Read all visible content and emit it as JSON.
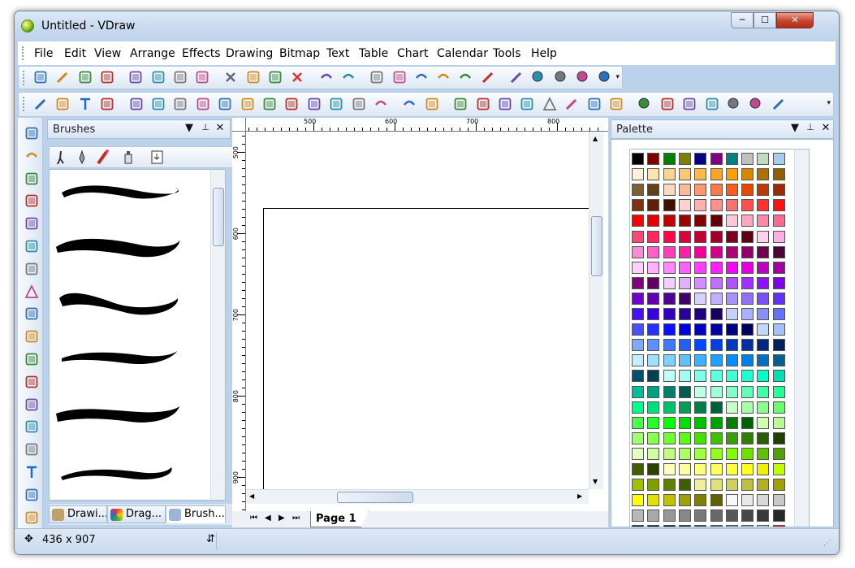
{
  "window": {
    "title": "Untitled - VDraw",
    "controls": [
      "─",
      "☐",
      "✕"
    ]
  },
  "menu": [
    "File",
    "Edit",
    "View",
    "Arrange",
    "Effects",
    "Drawing",
    "Bitmap",
    "Text",
    "Table",
    "Chart",
    "Calendar",
    "Tools",
    "Help"
  ],
  "toolbar_main": [
    "new-icon",
    "open-icon",
    "save-icon",
    "image-icon",
    "pdf-icon",
    "print-icon",
    "print-preview-icon",
    "frame-icon",
    "cut-icon",
    "copy-icon",
    "paste-icon",
    "delete-icon",
    "undo-icon",
    "redo-icon",
    "group-icon",
    "align-icon",
    "back-icon",
    "forward-icon",
    "rotate-icon",
    "pen-icon",
    "brush-icon",
    "zoom-in-icon",
    "zoom-out-icon",
    "zoom-100-icon",
    "help-icon"
  ],
  "toolbar_effects": [
    "pencil-icon",
    "gradient-icon",
    "texture-icon",
    "pattern-icon",
    "dots-icon",
    "grid-icon",
    "square-fill-icon",
    "cube-icon",
    "eraser-icon",
    "cylinder-icon",
    "hexagon-icon",
    "frame-square-icon",
    "mirror-icon",
    "leaf-icon",
    "flower-icon",
    "wave-icon",
    "twist-icon",
    "shadow-icon",
    "crop-icon",
    "dark-square-icon",
    "bevel-icon",
    "emboss-icon",
    "tree-icon",
    "ink-icon",
    "list-icon",
    "tag-icon",
    "ring-icon",
    "mosaic-icon",
    "gear-icon",
    "lasso-icon",
    "target-icon",
    "circle-dash-icon",
    "marker-icon"
  ],
  "left_tools": [
    "pointer-icon",
    "curve-icon",
    "rectangle-icon",
    "connector-icon",
    "dimension-icon",
    "flow-icon",
    "cup-icon",
    "triangle-icon",
    "film-icon",
    "org-chart-icon",
    "note-icon",
    "puzzle-icon",
    "layers-icon",
    "table-icon",
    "bar-chart-icon",
    "text-icon",
    "calendar-icon",
    "corner-icon"
  ],
  "brushes_panel": {
    "title": "Brushes",
    "controls": [
      "▼",
      "📌",
      "✕"
    ],
    "tabs": [
      {
        "label": "Drawi...",
        "icon": "drawing-tab-icon"
      },
      {
        "label": "Drag...",
        "icon": "drag-tab-icon"
      },
      {
        "label": "Brush...",
        "icon": "brush-tab-icon"
      }
    ]
  },
  "canvas": {
    "ruler_h": [
      "500",
      "600",
      "700",
      "800"
    ],
    "ruler_v": [
      "500",
      "600",
      "700",
      "800",
      "900"
    ],
    "page_tab": "Page 1"
  },
  "palette_panel": {
    "title": "Palette",
    "controls": [
      "▼",
      "📌",
      "✕"
    ]
  },
  "palette_rows": [
    [
      "#000000",
      "#800000",
      "#008000",
      "#808000",
      "#000080",
      "#800080",
      "#008080",
      "#c0c0c0",
      "#c0dcc0",
      "#a6caf0"
    ],
    [
      "#fff0d8",
      "#ffe4b0",
      "#ffd490",
      "#ffc870",
      "#ffb84c",
      "#ffa42a",
      "#ffa000",
      "#d88800",
      "#b07000",
      "#906000"
    ],
    [
      "#806030",
      "#604018",
      "#ffd8c0",
      "#ffb898",
      "#ff9870",
      "#ff7848",
      "#ff5a20",
      "#e84800",
      "#c03800",
      "#a02800"
    ],
    [
      "#803010",
      "#602008",
      "#401000",
      "#ffd0d0",
      "#ffb0b0",
      "#ff9090",
      "#ff7070",
      "#ff5050",
      "#ff3030",
      "#ff1010"
    ],
    [
      "#ff0000",
      "#e00000",
      "#c00000",
      "#a00000",
      "#800000",
      "#600000",
      "#ffc8d8",
      "#ffa8c0",
      "#ff88a8",
      "#ff6890"
    ],
    [
      "#ff4878",
      "#ff2860",
      "#ff0848",
      "#e0003c",
      "#c00034",
      "#a0002a",
      "#800020",
      "#600018",
      "#ffd0f0",
      "#ffb0e8"
    ],
    [
      "#ff88d8",
      "#ff60c8",
      "#ff40b8",
      "#ff20a8",
      "#f00098",
      "#d00088",
      "#b00078",
      "#900068",
      "#700050",
      "#500038"
    ],
    [
      "#ffd0ff",
      "#ffb0ff",
      "#ff88ff",
      "#ff60ff",
      "#ff40ff",
      "#ff20ff",
      "#ff00ff",
      "#e000e0",
      "#c000c0",
      "#a000a0"
    ],
    [
      "#800080",
      "#600060",
      "#f0d0ff",
      "#e0b0ff",
      "#d090ff",
      "#c070ff",
      "#b050ff",
      "#a030ff",
      "#9010ff",
      "#8000f0"
    ],
    [
      "#7000d0",
      "#6000b0",
      "#500090",
      "#400070",
      "#d8d0ff",
      "#c0b0ff",
      "#a890ff",
      "#9070ff",
      "#7850ff",
      "#6030ff"
    ],
    [
      "#4810ff",
      "#3800e0",
      "#3000c0",
      "#2800a0",
      "#200080",
      "#180060",
      "#c8d0ff",
      "#a8b0ff",
      "#8890ff",
      "#6870ff"
    ],
    [
      "#4850ff",
      "#2830ff",
      "#0810ff",
      "#0000e0",
      "#0000c0",
      "#0000a0",
      "#000080",
      "#000060",
      "#c0d8ff",
      "#a0c0ff"
    ],
    [
      "#80a8ff",
      "#6090ff",
      "#4078ff",
      "#2060ff",
      "#0048ff",
      "#0040e0",
      "#0038c0",
      "#0030a0",
      "#002880",
      "#002060"
    ],
    [
      "#c0f0ff",
      "#a0e0ff",
      "#80d0ff",
      "#60c0ff",
      "#40b0ff",
      "#20a0ff",
      "#0090ff",
      "#0080e0",
      "#0070c0",
      "#006090"
    ],
    [
      "#005070",
      "#004050",
      "#c0fff8",
      "#a0fff0",
      "#80ffe8",
      "#60ffe0",
      "#40ffd8",
      "#20ffd0",
      "#00ffc8",
      "#00e0b0"
    ],
    [
      "#00c098",
      "#00a080",
      "#008068",
      "#006050",
      "#c0ffe8",
      "#a0ffd8",
      "#80ffc8",
      "#60ffb8",
      "#40ffa8",
      "#20ff98"
    ],
    [
      "#00ff88",
      "#00e078",
      "#00c068",
      "#00a058",
      "#008048",
      "#006038",
      "#c8ffc8",
      "#a8ffa8",
      "#88ff88",
      "#68ff68"
    ],
    [
      "#48ff48",
      "#28ff28",
      "#08ff08",
      "#00e000",
      "#00c000",
      "#00a000",
      "#008000",
      "#006000",
      "#d0ffb0",
      "#b8ff90"
    ],
    [
      "#a0ff70",
      "#88ff50",
      "#70ff30",
      "#58ff10",
      "#48e000",
      "#40c000",
      "#38a000",
      "#308000",
      "#286000",
      "#204000"
    ],
    [
      "#e0ffc0",
      "#d0ffa0",
      "#c0ff80",
      "#b0ff60",
      "#a0ff40",
      "#90ff20",
      "#80ff00",
      "#70e000",
      "#60c000",
      "#50a000"
    ],
    [
      "#406000",
      "#304000",
      "#ffffc0",
      "#ffffa0",
      "#ffff80",
      "#ffff60",
      "#ffff40",
      "#ffff20",
      "#f0f000",
      "#c0ff00"
    ],
    [
      "#a0c000",
      "#80a000",
      "#608000",
      "#406000",
      "#f0f0a0",
      "#e0e080",
      "#d0d060",
      "#c0c040",
      "#b0b020",
      "#a0a000"
    ],
    [
      "#ffff00",
      "#e0e000",
      "#c0c000",
      "#a0a000",
      "#808000",
      "#606000",
      "#f8f8f8",
      "#e8e8e8",
      "#d8d8d8",
      "#c8c8c8"
    ],
    [
      "#b8b8b8",
      "#a8a8a8",
      "#989898",
      "#888888",
      "#787878",
      "#686868",
      "#585858",
      "#484848",
      "#383838",
      "#282828"
    ],
    [
      "#181818",
      "#080808",
      "#000000",
      "#202020",
      "#404040",
      "#606060",
      "#808080",
      "#a0a0a0",
      "#c0c0c0",
      "#ff0000"
    ]
  ],
  "status": {
    "text": "436 x 907"
  }
}
